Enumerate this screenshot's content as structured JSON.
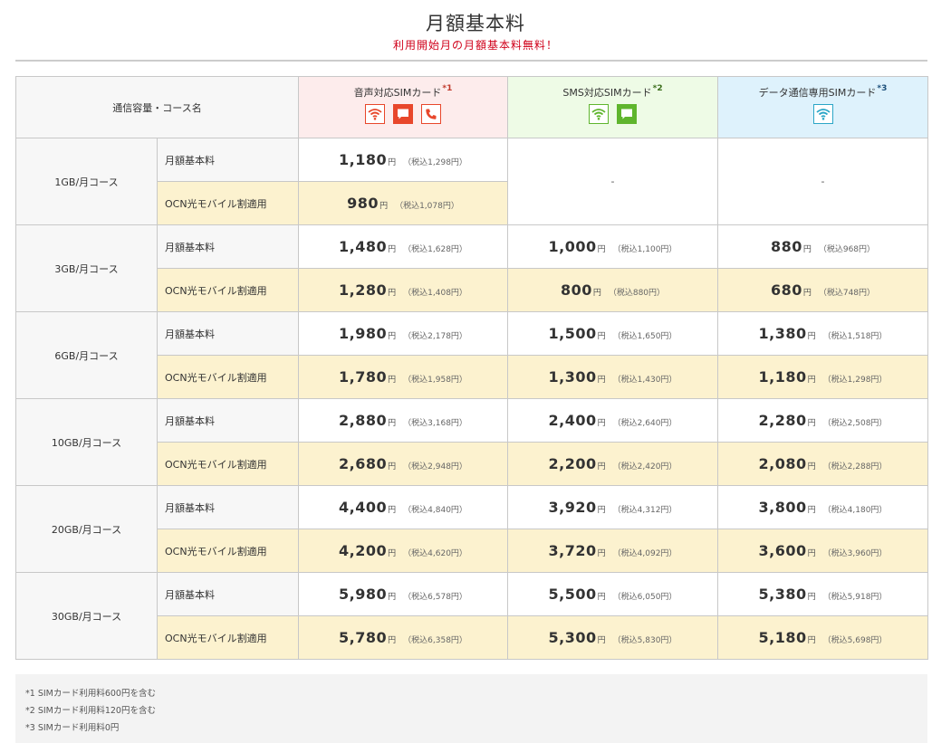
{
  "header": {
    "title": "月額基本料",
    "subtitle": "利用開始月の月額基本料無料！"
  },
  "table": {
    "corner_label": "通信容量・コース名",
    "columns": [
      {
        "name": "音声対応SIMカード",
        "note": "*1",
        "icons": [
          "wifi-icon",
          "message-icon",
          "phone-icon"
        ]
      },
      {
        "name": "SMS対応SIMカード",
        "note": "*2",
        "icons": [
          "wifi-icon",
          "message-icon"
        ]
      },
      {
        "name": "データ通信専用SIMカード",
        "note": "*3",
        "icons": [
          "wifi-icon"
        ]
      }
    ],
    "row_labels": {
      "base": "月額基本料",
      "discount": "OCN光モバイル割適用"
    },
    "yen": "円",
    "dash": "-",
    "courses": [
      {
        "name": "1GB/月コース",
        "base": [
          {
            "price": "1,180",
            "tax": "（税込1,298円）"
          },
          null,
          null
        ],
        "discount": [
          {
            "price": "980",
            "tax": "（税込1,078円）"
          }
        ]
      },
      {
        "name": "3GB/月コース",
        "base": [
          {
            "price": "1,480",
            "tax": "（税込1,628円）"
          },
          {
            "price": "1,000",
            "tax": "（税込1,100円）"
          },
          {
            "price": "880",
            "tax": "（税込968円）"
          }
        ],
        "discount": [
          {
            "price": "1,280",
            "tax": "（税込1,408円）"
          },
          {
            "price": "800",
            "tax": "（税込880円）"
          },
          {
            "price": "680",
            "tax": "（税込748円）"
          }
        ]
      },
      {
        "name": "6GB/月コース",
        "base": [
          {
            "price": "1,980",
            "tax": "（税込2,178円）"
          },
          {
            "price": "1,500",
            "tax": "（税込1,650円）"
          },
          {
            "price": "1,380",
            "tax": "（税込1,518円）"
          }
        ],
        "discount": [
          {
            "price": "1,780",
            "tax": "（税込1,958円）"
          },
          {
            "price": "1,300",
            "tax": "（税込1,430円）"
          },
          {
            "price": "1,180",
            "tax": "（税込1,298円）"
          }
        ]
      },
      {
        "name": "10GB/月コース",
        "base": [
          {
            "price": "2,880",
            "tax": "（税込3,168円）"
          },
          {
            "price": "2,400",
            "tax": "（税込2,640円）"
          },
          {
            "price": "2,280",
            "tax": "（税込2,508円）"
          }
        ],
        "discount": [
          {
            "price": "2,680",
            "tax": "（税込2,948円）"
          },
          {
            "price": "2,200",
            "tax": "（税込2,420円）"
          },
          {
            "price": "2,080",
            "tax": "（税込2,288円）"
          }
        ]
      },
      {
        "name": "20GB/月コース",
        "base": [
          {
            "price": "4,400",
            "tax": "（税込4,840円）"
          },
          {
            "price": "3,920",
            "tax": "（税込4,312円）"
          },
          {
            "price": "3,800",
            "tax": "（税込4,180円）"
          }
        ],
        "discount": [
          {
            "price": "4,200",
            "tax": "（税込4,620円）"
          },
          {
            "price": "3,720",
            "tax": "（税込4,092円）"
          },
          {
            "price": "3,600",
            "tax": "（税込3,960円）"
          }
        ]
      },
      {
        "name": "30GB/月コース",
        "base": [
          {
            "price": "5,980",
            "tax": "（税込6,578円）"
          },
          {
            "price": "5,500",
            "tax": "（税込6,050円）"
          },
          {
            "price": "5,380",
            "tax": "（税込5,918円）"
          }
        ],
        "discount": [
          {
            "price": "5,780",
            "tax": "（税込6,358円）"
          },
          {
            "price": "5,300",
            "tax": "（税込5,830円）"
          },
          {
            "price": "5,180",
            "tax": "（税込5,698円）"
          }
        ]
      }
    ]
  },
  "notes": [
    "*1 SIMカード利用料600円を含む",
    "*2 SIMカード利用料120円を含む",
    "*3 SIMカード利用料0円"
  ],
  "colors": {
    "accent_red": "#e8472b",
    "accent_green": "#5fb52d",
    "accent_cyan": "#2ba6c7",
    "subtitle_red": "#d0021b",
    "discount_row_bg": "#fcf2cf"
  }
}
